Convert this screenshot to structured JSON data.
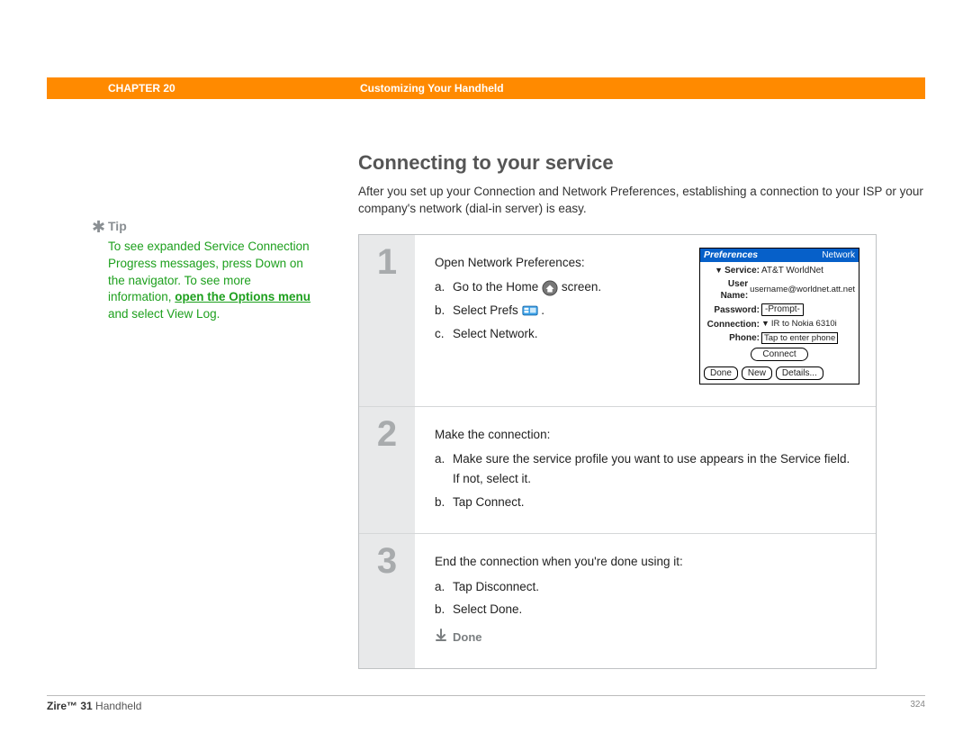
{
  "header": {
    "chapter_label": "CHAPTER 20",
    "chapter_title": "Customizing Your Handheld"
  },
  "sidebar": {
    "tip_heading": "Tip",
    "tip_body_1": "To see expanded Service Connection Progress messages, press Down on the navigator. To see more information, ",
    "tip_link": "open the Options menu ",
    "tip_body_2": "and select View Log."
  },
  "main": {
    "heading": "Connecting to your service",
    "intro": "After you set up your Connection and Network Preferences, establishing a connection to your ISP or your company's network (dial-in server) is easy."
  },
  "steps": [
    {
      "num": "1",
      "title": "Open Network Preferences:",
      "items": [
        {
          "l": "a.",
          "pre": "Go to the Home ",
          "icon": "home",
          "post": " screen."
        },
        {
          "l": "b.",
          "pre": "Select Prefs ",
          "icon": "prefs",
          "post": " ."
        },
        {
          "l": "c.",
          "pre": "Select Network.",
          "icon": "",
          "post": ""
        }
      ]
    },
    {
      "num": "2",
      "title": "Make the connection:",
      "items": [
        {
          "l": "a.",
          "pre": "Make sure the service profile you want to use appears in the Service field. If not, select it.",
          "icon": "",
          "post": ""
        },
        {
          "l": "b.",
          "pre": "Tap Connect.",
          "icon": "",
          "post": ""
        }
      ]
    },
    {
      "num": "3",
      "title": "End the connection when you're done using it:",
      "items": [
        {
          "l": "a.",
          "pre": "Tap Disconnect.",
          "icon": "",
          "post": ""
        },
        {
          "l": "b.",
          "pre": "Select Done.",
          "icon": "",
          "post": ""
        }
      ],
      "done": "Done"
    }
  ],
  "palm": {
    "title": "Preferences",
    "title_right": "Network",
    "rows": {
      "service_label": "Service:",
      "service_val": "AT&T WorldNet",
      "user_label": "User Name:",
      "user_val": "username@worldnet.att.net",
      "pwd_label": "Password:",
      "pwd_val": "-Prompt-",
      "conn_label": "Connection:",
      "conn_val": "IR to Nokia 6310i",
      "phone_label": "Phone:",
      "phone_val": "Tap to enter phone"
    },
    "connect_btn": "Connect",
    "buttons": {
      "done": "Done",
      "new": "New",
      "details": "Details..."
    }
  },
  "footer": {
    "product_bold": "Zire™ 31",
    "product_rest": " Handheld",
    "page": "324"
  }
}
